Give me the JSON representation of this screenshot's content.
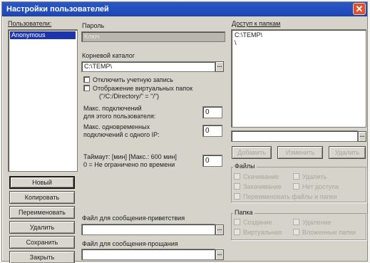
{
  "window": {
    "title": "Настройки пользователей",
    "close_glyph": "✕",
    "close_icon": "close-icon"
  },
  "users": {
    "label": "Пользователи:",
    "items": [
      "Anonymous"
    ],
    "selected": "Anonymous"
  },
  "password": {
    "label": "Пароль",
    "value": "Ключ"
  },
  "root_dir": {
    "label": "Корневой каталог",
    "value": "C:\\TEMP\\",
    "browse_label": "..."
  },
  "options": {
    "disable_account": "Отключить учетную запись",
    "virtual_folders_line1": "Отображение виртуальных папок",
    "virtual_folders_line2": "(\"/C:/Directory/\" = \"/\")"
  },
  "limits": {
    "max_connections_line1": "Макс. подключений",
    "max_connections_line2": "для этого пользователя:",
    "max_connections_value": "0",
    "max_simultaneous_line1": "Макс. одновременных",
    "max_simultaneous_line2": "подключений с одного IP:",
    "max_simultaneous_value": "0",
    "timeout_line1": "Таймаут: [мин] [Макс.: 600 мин]",
    "timeout_line2": "0 = Не ограничено по времени",
    "timeout_value": "0"
  },
  "user_buttons": {
    "new": "Новый",
    "copy": "Копировать",
    "rename": "Переименовать",
    "delete": "Удалить",
    "save": "Сохранить",
    "close": "Закрыть"
  },
  "messages": {
    "welcome_label": "Файл для сообщения-приветствия",
    "goodbye_label": "Файл для сообщения-прощания",
    "browse_label": "..."
  },
  "folder_access": {
    "label": "Доступ к папкам",
    "items": [
      "C:\\TEMP\\",
      "\\"
    ],
    "path_value": "",
    "browse_label": "...",
    "add": "Добавить",
    "edit": "Изменить",
    "remove": "Удалить"
  },
  "files": {
    "title": "Файлы",
    "download": "Скачивание",
    "delete": "Удалить",
    "upload": "Закачивание",
    "no_access": "Нет доступа",
    "rename": "Переименовать файлы и папки"
  },
  "folder": {
    "title": "Папка",
    "create": "Создание",
    "delete": "Удаление",
    "virtual": "Виртуальная",
    "nested": "Вложенные папки"
  }
}
